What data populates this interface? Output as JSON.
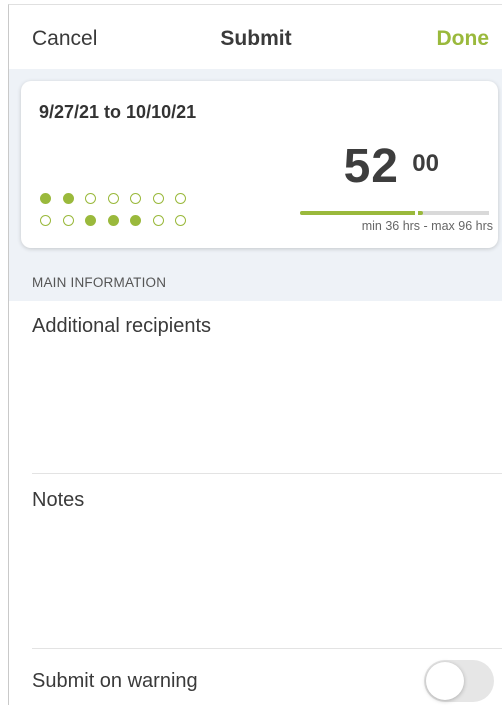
{
  "nav": {
    "cancel_label": "Cancel",
    "title": "Submit",
    "done_label": "Done"
  },
  "summary": {
    "date_range": "9/27/21 to 10/10/21",
    "week1_days": [
      true,
      true,
      false,
      false,
      false,
      false,
      false
    ],
    "week2_days": [
      false,
      false,
      true,
      true,
      true,
      false,
      false
    ],
    "hours_whole": "52",
    "hours_decimal": "00",
    "progress_fraction": 0.64,
    "min_marker_fraction": 0.375,
    "max_marker_fraction": 1.0,
    "range_label": "min 36 hrs - max 96 hrs"
  },
  "section": {
    "header": "MAIN INFORMATION"
  },
  "fields": {
    "recipients_label": "Additional recipients",
    "notes_label": "Notes",
    "submit_on_warning_label": "Submit on warning",
    "submit_on_warning_enabled": false
  },
  "colors": {
    "accent": "#9ab93c",
    "section_background": "#eef2f7"
  }
}
